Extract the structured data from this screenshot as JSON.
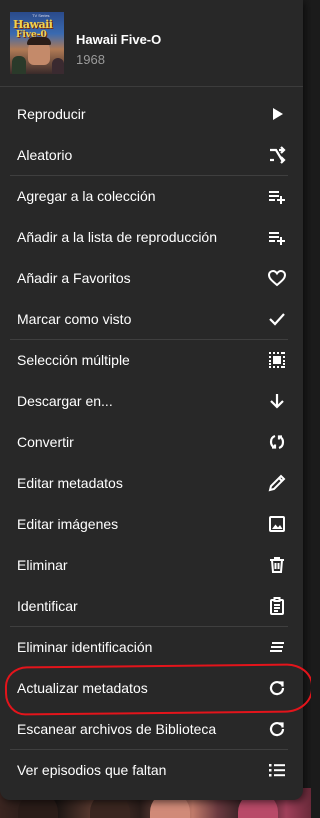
{
  "header": {
    "title": "Hawaii Five-O",
    "year": "1968",
    "poster": {
      "tag": "TV Series",
      "title_line1": "Hawaii",
      "title_line2": "Five-0"
    }
  },
  "menu": {
    "items": [
      {
        "label": "Reproducir",
        "icon": "play-icon"
      },
      {
        "label": "Aleatorio",
        "icon": "shuffle-icon"
      },
      {
        "label": "Agregar a la colección",
        "icon": "playlist-add-icon"
      },
      {
        "label": "Añadir a la lista de reproducción",
        "icon": "playlist-add-icon"
      },
      {
        "label": "Añadir a Favoritos",
        "icon": "heart-icon"
      },
      {
        "label": "Marcar como visto",
        "icon": "check-icon"
      },
      {
        "label": "Selección múltiple",
        "icon": "multi-select-icon"
      },
      {
        "label": "Descargar en...",
        "icon": "arrow-down-icon"
      },
      {
        "label": "Convertir",
        "icon": "convert-icon"
      },
      {
        "label": "Editar metadatos",
        "icon": "pencil-icon"
      },
      {
        "label": "Editar imágenes",
        "icon": "image-icon"
      },
      {
        "label": "Eliminar",
        "icon": "trash-icon"
      },
      {
        "label": "Identificar",
        "icon": "clipboard-icon"
      },
      {
        "label": "Eliminar identificación",
        "icon": "clear-all-icon"
      },
      {
        "label": "Actualizar metadatos",
        "icon": "refresh-icon"
      },
      {
        "label": "Escanear archivos de Biblioteca",
        "icon": "refresh-icon"
      },
      {
        "label": "Ver episodios que faltan",
        "icon": "list-icon"
      }
    ]
  },
  "colors": {
    "menu_bg": "#282828",
    "text": "#ffffff",
    "secondary_text": "#9a9a9a",
    "annotation_ring": "#e3141b"
  }
}
